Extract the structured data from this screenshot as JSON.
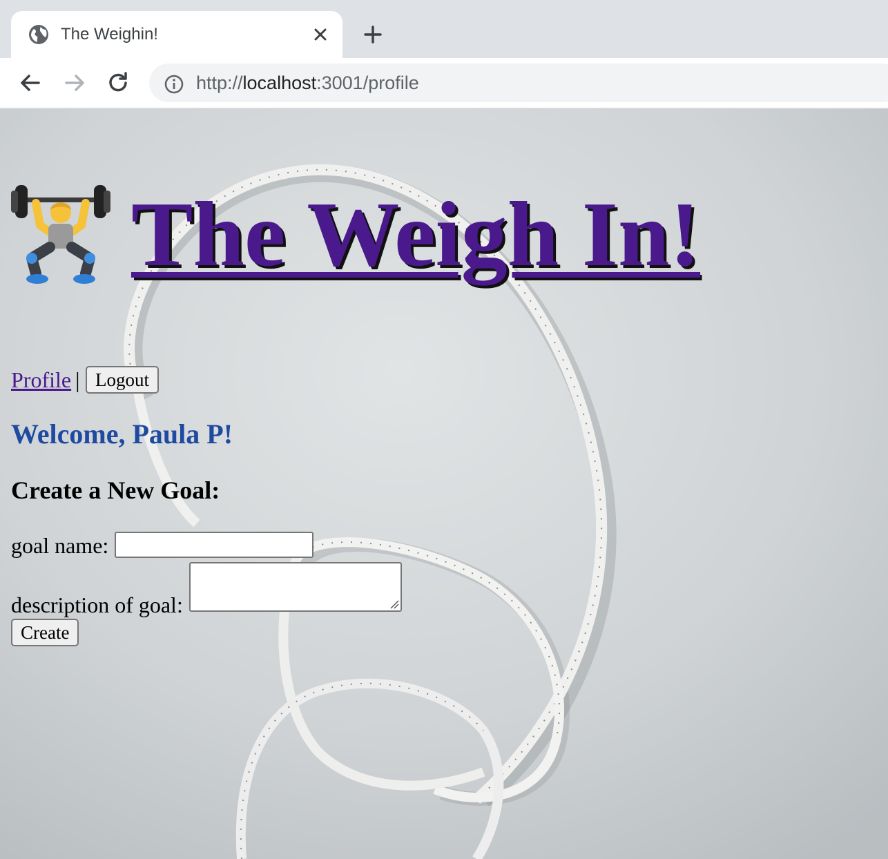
{
  "browser": {
    "tab_title": "The Weighin!",
    "url_scheme": "http://",
    "url_host": "localhost",
    "url_path": ":3001/profile"
  },
  "header": {
    "logo_emoji": "🏋️",
    "title": "The Weigh In!"
  },
  "nav": {
    "profile_link": "Profile",
    "separator": "|",
    "logout_button": "Logout"
  },
  "welcome": "Welcome, Paula P!",
  "goal_form": {
    "heading": "Create a New Goal:",
    "name_label": "goal name:",
    "name_value": "",
    "description_label": "description of goal:",
    "description_value": "",
    "submit_label": "Create"
  },
  "colors": {
    "title": "#4a1a8c",
    "welcome": "#1f4aa0",
    "link": "#4a1a8c"
  }
}
